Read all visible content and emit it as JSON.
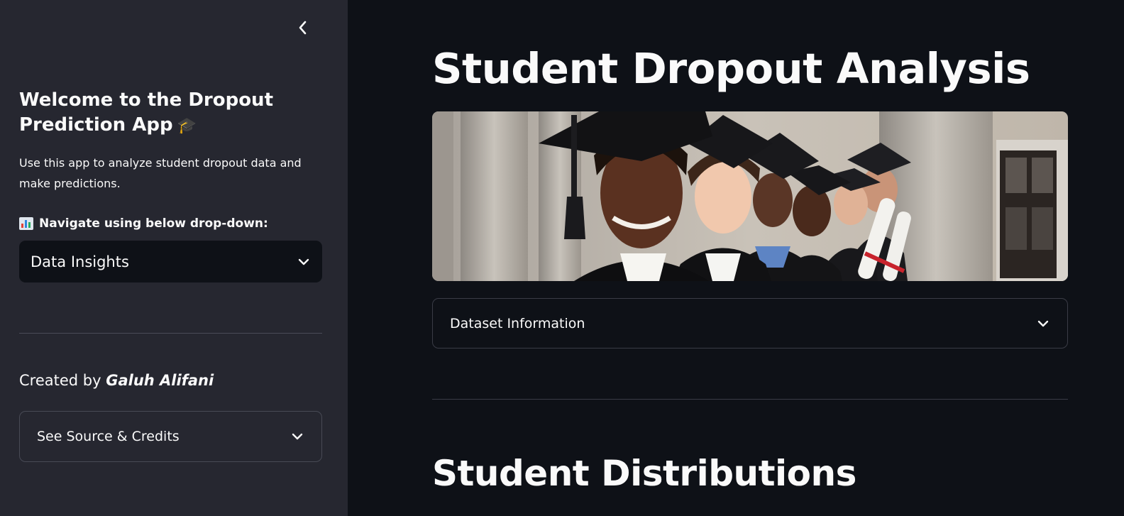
{
  "sidebar": {
    "collapse_icon": "chevron-left-icon",
    "title": "Welcome to the Dropout Prediction App",
    "title_emoji": "🎓",
    "description": "Use this app to analyze student dropout data and make predictions.",
    "nav_label": "Navigate using below drop-down:",
    "nav_emoji": "bar-chart-icon",
    "select": {
      "value": "Data Insights",
      "icon": "chevron-down-icon"
    },
    "created_prefix": "Created by",
    "created_author": "Galuh Alifani",
    "credits_expander": {
      "label": "See Source & Credits",
      "icon": "chevron-down-icon"
    }
  },
  "main": {
    "title": "Student Dropout Analysis",
    "banner_image": "graduates-photo",
    "dataset_expander": {
      "label": "Dataset Information",
      "icon": "chevron-down-icon"
    },
    "section_title": "Student Distributions"
  },
  "colors": {
    "main_background": "#0e1117",
    "sidebar_background": "#262730",
    "text": "#fafafa",
    "border": "#3a3c46"
  }
}
